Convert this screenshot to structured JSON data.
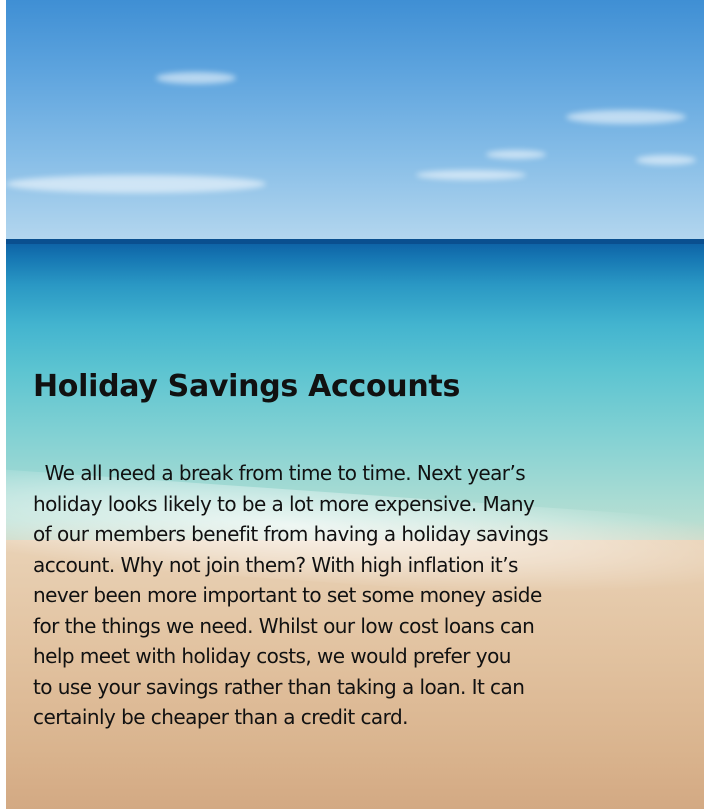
{
  "article": {
    "title": "Holiday Savings Accounts",
    "body_lines": [
      "  We all need a break from time to time. Next year’s",
      "holiday looks likely to be a lot more expensive. Many",
      "of our members benefit from having a holiday savings",
      "account. Why not join them? With high inflation it’s",
      "never been more important to set some money aside",
      "for the things we need. Whilst our low cost loans can",
      "help meet with holiday costs, we would prefer you",
      "to use your savings rather than taking a loan. It can",
      "certainly be cheaper than a credit card."
    ]
  },
  "background": {
    "description_icon": "beach-photo",
    "colors": {
      "sky_top": "#3f8fd4",
      "sky_bottom": "#b3d6ee",
      "sea_deep": "#0c5ea3",
      "sea_shallow": "#7fd0d3",
      "sand": "#e2c3a1",
      "text": "#111111"
    }
  }
}
